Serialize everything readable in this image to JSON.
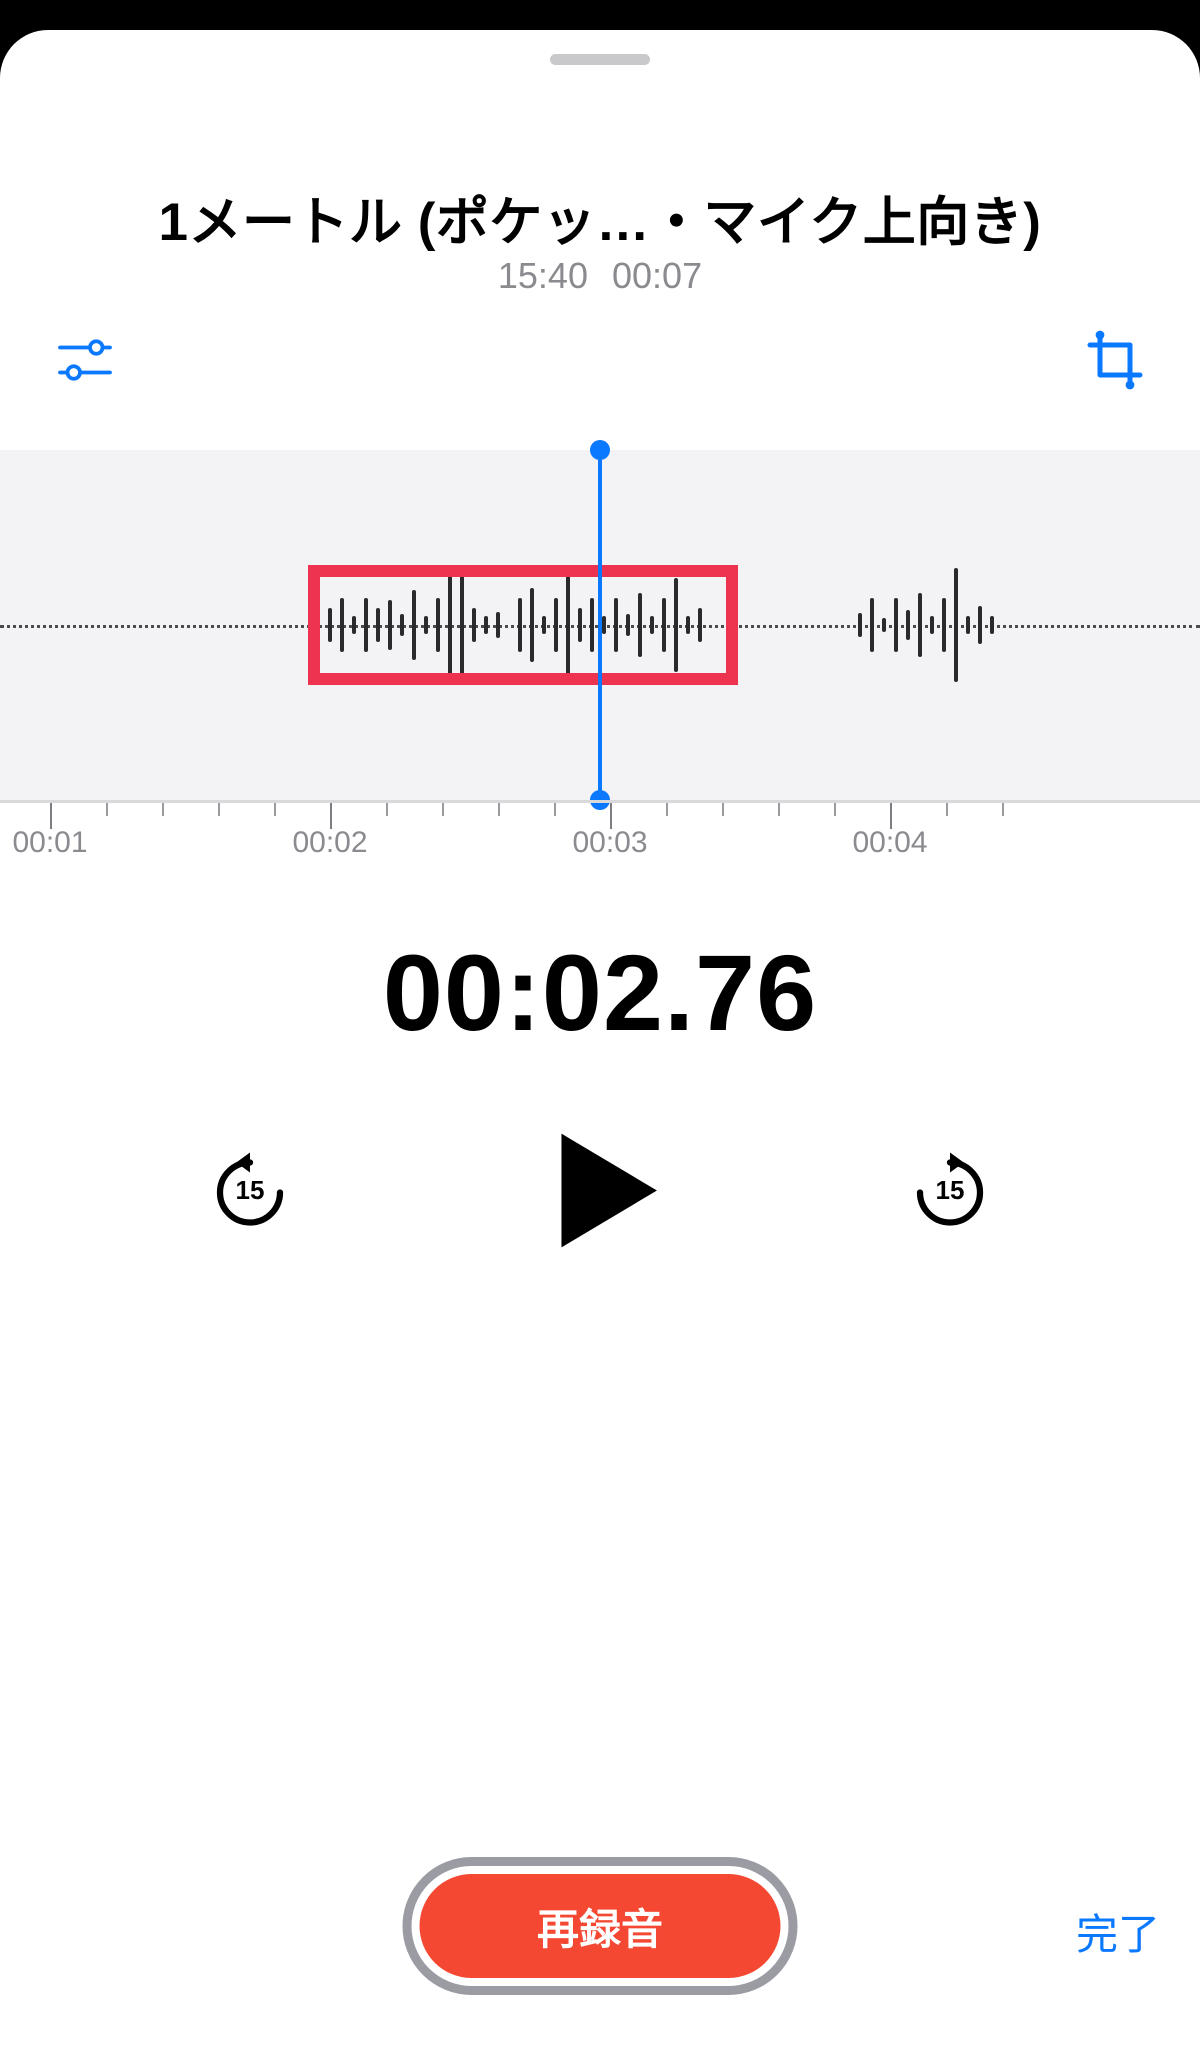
{
  "title": "1メートル (ポケッ…・マイク上向き)",
  "meta": {
    "time": "15:40",
    "duration": "00:07"
  },
  "elapsed": "00:02.76",
  "ruler": [
    "00:01",
    "00:02",
    "00:03",
    "00:04"
  ],
  "colors": {
    "accent": "#0a78ff",
    "record": "#f44832",
    "highlight": "#ee3350"
  },
  "footer": {
    "record": "再録音",
    "done": "完了"
  },
  "skip": {
    "seconds": "15"
  },
  "icons": {
    "options": "sliders-icon",
    "crop": "crop-icon",
    "skipBack": "skip-back-15-icon",
    "skipFwd": "skip-forward-15-icon",
    "play": "play-icon"
  }
}
